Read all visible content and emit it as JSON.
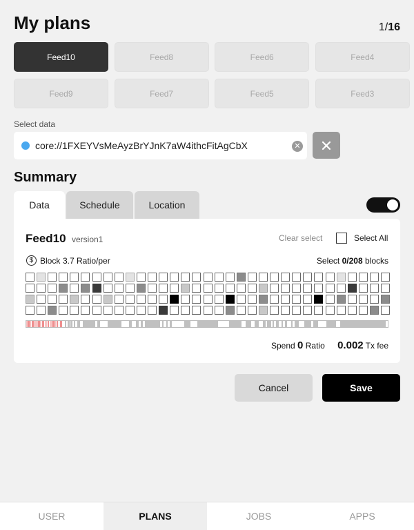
{
  "header": {
    "title": "My plans",
    "page_current": "1",
    "page_total": "16"
  },
  "feeds": [
    "Feed10",
    "Feed8",
    "Feed6",
    "Feed4",
    "Feed9",
    "Feed7",
    "Feed5",
    "Feed3"
  ],
  "active_feed_index": 0,
  "select": {
    "label": "Select data",
    "value": "core://1FXEYVsMeAyzBrYJnK7aW4ithcFitAgCbX",
    "clear_icon": "circle-x-icon",
    "close_icon": "close-icon"
  },
  "summary": {
    "title": "Summary",
    "tabs": [
      "Data",
      "Schedule",
      "Location"
    ],
    "active_tab": "Data",
    "toggle_on": true,
    "feed_name": "Feed10",
    "feed_version": "version1",
    "clear_select": "Clear select",
    "select_all": "Select All",
    "block_label": "Block",
    "ratio": "3.7 Ratio/per",
    "select_prefix": "Select",
    "selected": "0/208",
    "select_suffix": "blocks",
    "spend_label": "Spend",
    "spend_value": "0",
    "spend_unit": "Ratio",
    "fee_value": "0.002",
    "fee_unit": "Tx fee"
  },
  "block_grid": {
    "columns": 33,
    "rows": [
      "010000000100000000030000000010000",
      "000303400030002000000200000004000",
      "200020020000050000500300005030003",
      "003000000000400000300200000000030"
    ]
  },
  "buttons": {
    "cancel": "Cancel",
    "save": "Save"
  },
  "nav": {
    "items": [
      "USER",
      "PLANS",
      "JOBS",
      "APPS"
    ],
    "active": "PLANS"
  },
  "colors": {
    "accent_dot": "#4aa8ef",
    "active_feed": "#333333",
    "timeline_pink": "#f4a6a6",
    "timeline_gray": "#bdbdbd"
  }
}
